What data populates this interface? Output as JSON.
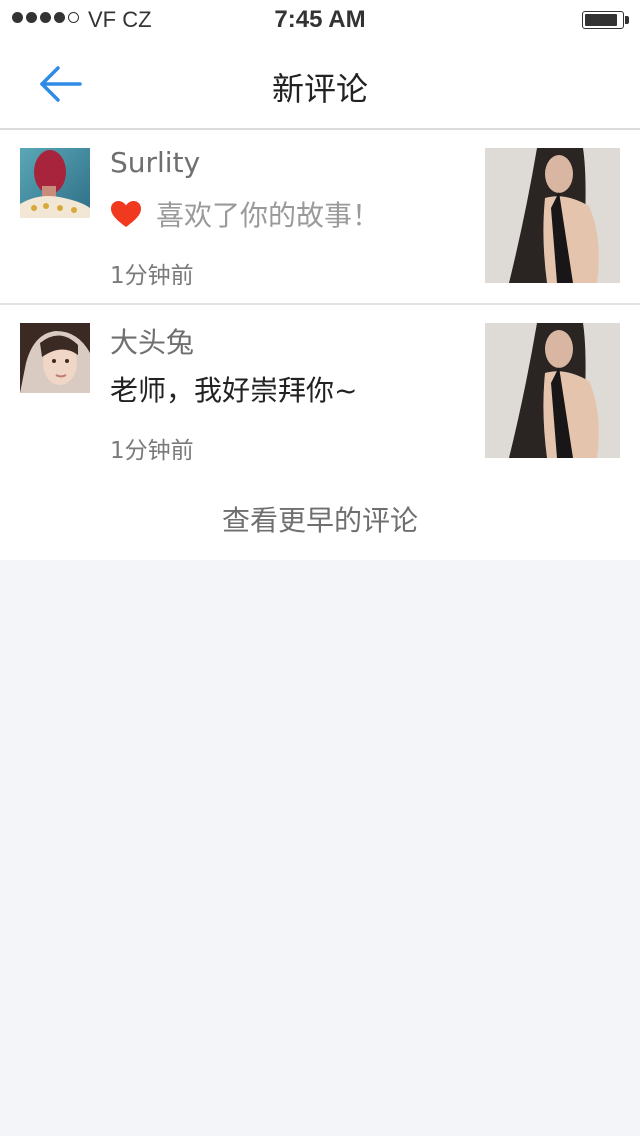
{
  "status_bar": {
    "carrier": "VF CZ",
    "time": "7:45 AM",
    "signal_icon": "signal-dots-icon",
    "battery_icon": "battery-icon"
  },
  "nav": {
    "title": "新评论",
    "back_icon": "back-arrow-icon",
    "accent_color": "#2f8be6"
  },
  "notifications": [
    {
      "username": "Surlity",
      "action_icon": "heart-icon",
      "comment": "喜欢了你的故事！",
      "time": "1分钟前"
    },
    {
      "username": "大头兔",
      "comment": "老师，我好崇拜你~",
      "time": "1分钟前"
    }
  ],
  "load_more_label": "查看更早的评论",
  "colors": {
    "heart": "#f0391e",
    "page_background": "#f4f5f9"
  }
}
